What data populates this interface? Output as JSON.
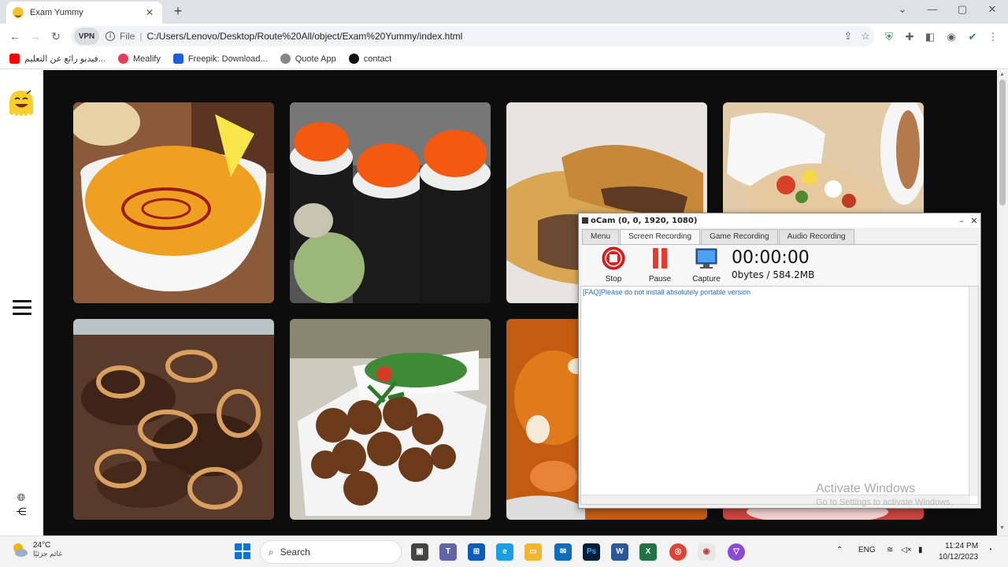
{
  "browser": {
    "tab_title": "Exam Yummy",
    "tab_close": "✕",
    "new_tab": "+",
    "window_min": "⌄",
    "window_minimize": "—",
    "window_restore": "▢",
    "window_close": "✕",
    "vpn_label": "VPN",
    "scheme": "File",
    "url": "C:/Users/Lenovo/Desktop/Route%20All/object/Exam%20Yummy/index.html"
  },
  "bookmarks": [
    {
      "label": "فيديو رائع عن التعليم...",
      "color": "#ff0000"
    },
    {
      "label": "Mealify",
      "color": "#e0405a"
    },
    {
      "label": "Freepik: Download...",
      "color": "#1c5fd6"
    },
    {
      "label": "Quote App",
      "color": "#666666"
    },
    {
      "label": "contact",
      "color": "#111111"
    }
  ],
  "ocam": {
    "title": "oCam (0, 0, 1920, 1080)",
    "tabs": [
      "Menu",
      "Screen Recording",
      "Game Recording",
      "Audio Recording"
    ],
    "stop_label": "Stop",
    "pause_label": "Pause",
    "capture_label": "Capture",
    "timer": "00:00:00",
    "size": "0bytes / 584.2MB",
    "log_message": "[FAQ]Please do not install absolutely portable version"
  },
  "watermark": {
    "line1": "Activate Windows",
    "line2": "Go to Settings to activate Windows."
  },
  "taskbar": {
    "temperature": "24°C",
    "weather_desc": "غائم جزئيًا",
    "search_label": "Search",
    "language": "ENG",
    "time": "11:24 PM",
    "date": "10/12/2023"
  }
}
